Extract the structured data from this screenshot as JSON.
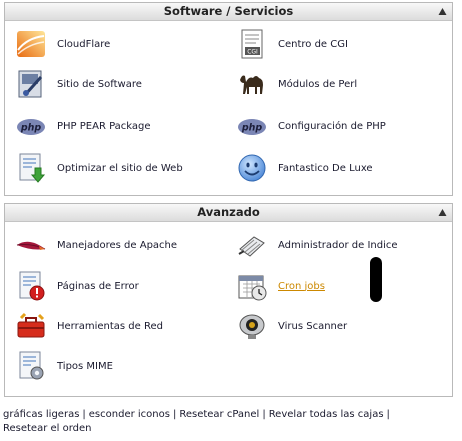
{
  "software": {
    "title": "Software / Servicios",
    "items": [
      {
        "label": "CloudFlare",
        "icon": "cloudflare-icon"
      },
      {
        "label": "Centro de CGI",
        "icon": "cgi-center-icon"
      },
      {
        "label": "Sitio de Software",
        "icon": "software-site-icon"
      },
      {
        "label": "Módulos de Perl",
        "icon": "perl-camel-icon"
      },
      {
        "label": "PHP PEAR Package",
        "icon": "php-icon"
      },
      {
        "label": "Configuración de PHP",
        "icon": "php-icon"
      },
      {
        "label": "Optimizar el sitio de Web",
        "icon": "optimize-site-icon"
      },
      {
        "label": "Fantastico De Luxe",
        "icon": "smiley-icon"
      }
    ]
  },
  "avanzado": {
    "title": "Avanzado",
    "items": [
      {
        "label": "Manejadores de Apache",
        "icon": "apache-feather-icon"
      },
      {
        "label": "Administrador de Indice",
        "icon": "index-manager-icon"
      },
      {
        "label": "Páginas de Error",
        "icon": "error-page-icon"
      },
      {
        "label": "Cron jobs",
        "icon": "calendar-clock-icon",
        "style": "link"
      },
      {
        "label": "Herramientas de Red",
        "icon": "network-tools-icon"
      },
      {
        "label": "Virus Scanner",
        "icon": "webcam-icon"
      },
      {
        "label": "Tipos MIME",
        "icon": "mime-types-icon"
      }
    ]
  },
  "footer": {
    "links": [
      "gráficas ligeras",
      "esconder iconos",
      "Resetear cPanel",
      "Revelar todas las cajas",
      "Resetear el orden"
    ],
    "separator": "|"
  },
  "colors": {
    "header_gradient_top": "#f8f8f8",
    "header_gradient_bottom": "#dcdcdc",
    "border": "#b9b9b9",
    "link_active": "#cc8800",
    "text": "#1a1a2e"
  }
}
